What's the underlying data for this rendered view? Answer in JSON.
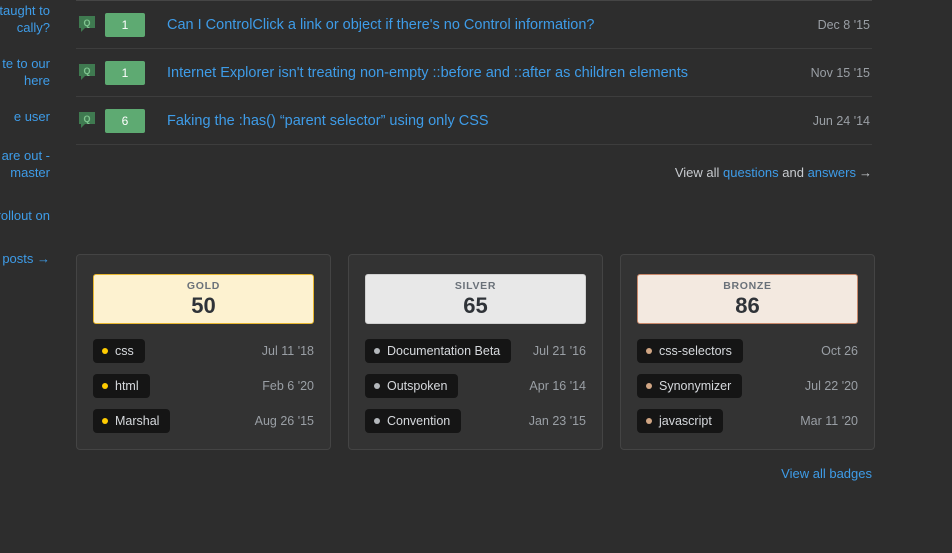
{
  "sidebar_clipped": {
    "lines": [
      "taught to",
      "cally?",
      "te to our",
      "here",
      "e user",
      "are out -",
      "master",
      "rollout on",
      "posts →"
    ]
  },
  "post_list": {
    "icon_name": "question-bubble-icon",
    "posts": [
      {
        "score": "1",
        "title": "Can I ControlClick a link or object if there's no Control information?",
        "date": "Dec 8 '15"
      },
      {
        "score": "1",
        "title": "Internet Explorer isn't treating non-empty ::before and ::after as children elements",
        "date": "Nov 15 '15"
      },
      {
        "score": "6",
        "title": "Faking the :has() “parent selector” using only CSS",
        "date": "Jun 24 '14"
      }
    ],
    "view_all": {
      "prefix": "View all ",
      "questions_label": "questions",
      "conjunction": " and ",
      "answers_label": "answers",
      "arrow": "→"
    }
  },
  "badges": {
    "cards": [
      {
        "tier": "GOLD",
        "count": "50",
        "tier_class": "gold",
        "items": [
          {
            "name": "css",
            "date": "Jul 11 '18"
          },
          {
            "name": "html",
            "date": "Feb 6 '20"
          },
          {
            "name": "Marshal",
            "date": "Aug 26 '15"
          }
        ]
      },
      {
        "tier": "SILVER",
        "count": "65",
        "tier_class": "silver",
        "items": [
          {
            "name": "Documentation Beta",
            "date": "Jul 21 '16"
          },
          {
            "name": "Outspoken",
            "date": "Apr 16 '14"
          },
          {
            "name": "Convention",
            "date": "Jan 23 '15"
          }
        ]
      },
      {
        "tier": "BRONZE",
        "count": "86",
        "tier_class": "bronze",
        "items": [
          {
            "name": "css-selectors",
            "date": "Oct 26"
          },
          {
            "name": "Synonymizer",
            "date": "Jul 22 '20"
          },
          {
            "name": "javascript",
            "date": "Mar 11 '20"
          }
        ]
      }
    ],
    "view_all_label": "View all badges"
  },
  "colors": {
    "page_bg": "#2d2d2d",
    "link": "#3e9ce8",
    "score_green": "#5eaa72",
    "gold_bg": "#fdf2d0",
    "gold_border": "#e8b730",
    "silver_bg": "#e8e8e8",
    "silver_border": "#d0d0d0",
    "bronze_bg": "#f3e9e0",
    "bronze_border": "#c9886a"
  }
}
